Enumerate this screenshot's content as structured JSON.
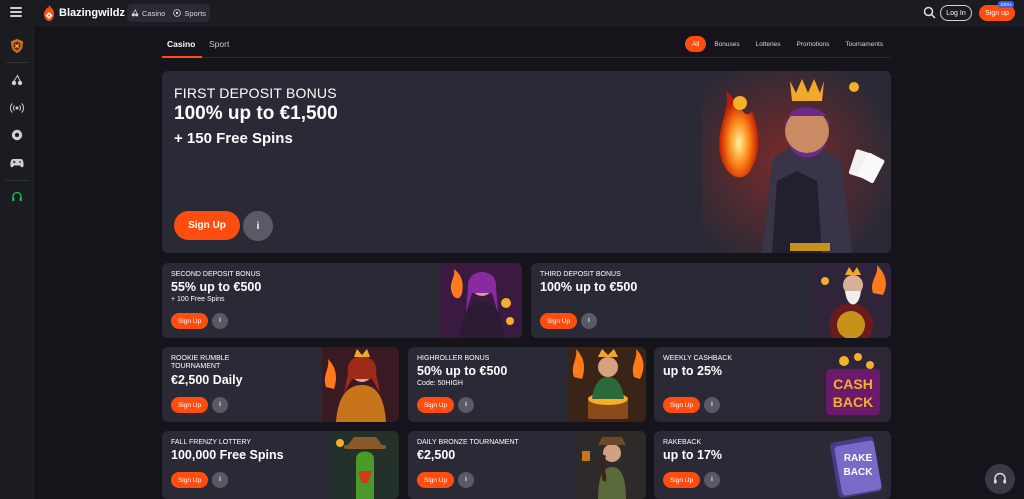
{
  "header": {
    "brand": "Blazingwildz",
    "modes": [
      {
        "label": "Casino",
        "icon": "cherries-icon"
      },
      {
        "label": "Sports",
        "icon": "soccer-ball-icon"
      }
    ],
    "login_label": "Log In",
    "signup_label": "Sign up",
    "signup_badge": "100%"
  },
  "sidebar": {
    "items": [
      "shield-logo-icon",
      "cherries-icon",
      "live-broadcast-icon",
      "soccer-ball-icon",
      "gamepad-icon",
      "headset-icon"
    ]
  },
  "tabs": {
    "main": [
      "Casino",
      "Sport"
    ],
    "active_main": "Casino",
    "filters": [
      "All",
      "Bonuses",
      "Lotteries",
      "Promotions",
      "Tournaments"
    ],
    "active_filter": "All"
  },
  "hero": {
    "subtitle": "FIRST DEPOSIT BONUS",
    "title": "100% up to €1,500",
    "title2": "+ 150 Free Spins",
    "signup_label": "Sign Up",
    "info_label": "i"
  },
  "cards": [
    {
      "label": "SECOND DEPOSIT BONUS",
      "title": "55% up to €500",
      "sub": "+ 100 Free Spins",
      "signup": "Sign Up",
      "info": "i"
    },
    {
      "label": "THIRD DEPOSIT BONUS",
      "title": "100% up to €500",
      "sub": "",
      "signup": "Sign Up",
      "info": "i"
    },
    {
      "label": "ROOKIE RUMBLE\nTOURNAMENT",
      "title": "€2,500 Daily",
      "sub": "",
      "signup": "Sign Up",
      "info": "i"
    },
    {
      "label": "HIGHROLLER BONUS",
      "title": "50% up to €500",
      "sub": "Code: 50HIGH",
      "signup": "Sign Up",
      "info": "i"
    },
    {
      "label": "WEEKLY CASHBACK",
      "title": "up to 25%",
      "sub": "",
      "signup": "Sign Up",
      "info": "i"
    },
    {
      "label": "FALL FRENZY LOTTERY",
      "title": "100,000 Free Spins",
      "sub": "",
      "signup": "Sign Up",
      "info": "i"
    },
    {
      "label": "DAILY BRONZE TOURNAMENT",
      "title": "€2,500",
      "sub": "",
      "signup": "Sign Up",
      "info": "i"
    },
    {
      "label": "RAKEBACK",
      "title": "up to 17%",
      "sub": "",
      "signup": "Sign Up",
      "info": "i"
    }
  ],
  "art_text": {
    "cashback": [
      "CASH",
      "BACK"
    ],
    "rakeback": [
      "RAKE",
      "BACK"
    ]
  },
  "colors": {
    "accent": "#ff4d10",
    "card": "#2a2a36",
    "bg": "#14141a"
  }
}
